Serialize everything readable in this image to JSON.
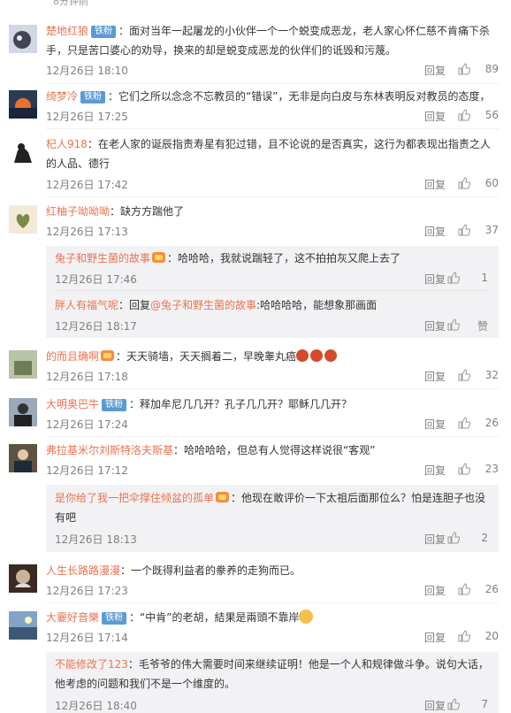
{
  "top_fragment": "8分钟前",
  "reply_label": "回复",
  "comments": [
    {
      "user": "楚地红狼",
      "badge": "铁粉",
      "text": "：面对当年一起屠龙的小伙伴一个一个蜕变成恶龙，老人家心怀仁慈不肯痛下杀手，只是苦口婆心的劝导，换来的却是蜕变成恶龙的伙伴们的诋毁和污蔑。",
      "date": "12月26日 18:10",
      "likes": "89"
    },
    {
      "user": "绮梦冷",
      "badge": "铁粉",
      "text": "：它们之所以念念不忘教员的“错误”，无非是向白皮与东林表明反对教员的态度，",
      "date": "12月26日 17:25",
      "likes": "56"
    },
    {
      "user": "杞人918",
      "badge": "",
      "text": "：在老人家的诞辰指责寿星有犯过错，且不论说的是否真实，这行为都表现出指责之人的人品、德行",
      "date": "12月26日 17:42",
      "likes": "60"
    },
    {
      "user": "红柚子呦呦呦",
      "badge": "",
      "text": "：缺方方踹他了",
      "date": "12月26日 17:13",
      "likes": "37"
    },
    {
      "user": "的而且确啊",
      "badge": "",
      "text": "：天天骑墙，天天搁着二，早晚睾丸癌",
      "date": "12月26日 17:18",
      "likes": "32"
    },
    {
      "user": "大明奥巴牛",
      "badge": "铁粉",
      "text": "：释加牟尼几几开？孔子几几开？耶稣几几开？",
      "date": "12月26日 17:24",
      "likes": "26"
    },
    {
      "user": "弗拉基米尔刘斯特洛夫斯基",
      "badge": "",
      "text": "：哈哈哈哈，但总有人觉得这样说很“客观”",
      "date": "12月26日 17:12",
      "likes": "23"
    },
    {
      "user": "人生长路路漫漫",
      "badge": "",
      "text": "：一个既得利益者的豢养的走狗而已。",
      "date": "12月26日 17:23",
      "likes": "26"
    },
    {
      "user": "大嫑好音樂",
      "badge": "铁粉",
      "text": "：“中肯”的老胡，結果是兩頭不靠岸",
      "date": "12月26日 17:14",
      "likes": "20"
    }
  ],
  "replies": [
    {
      "user": "兔子和野生菌的故事",
      "text": "：哈哈哈，我就说踹轻了，这不拍拍灰又爬上去了",
      "date": "12月26日 17:46",
      "likes": "1"
    },
    {
      "user": "胖人有福气呢",
      "text": "：回复",
      "mention": "@兔子和野生菌的故事",
      "text2": ":哈哈哈哈，能想象那画面",
      "date": "12月26日 18:17",
      "likes": "赞"
    },
    {
      "user": "是你给了我一把伞撑住倾盆的孤单",
      "text": "：他现在敢评价一下太祖后面那位么？怕是连胆子也没有吧",
      "date": "12月26日 18:13",
      "likes": "2"
    },
    {
      "user": "不能修改了123",
      "text": "：毛爷爷的伟大需要时间来继续证明！他是一个人和规律做斗争。说句大话，他考虑的问题和我们不是一个维度的。",
      "date": "12月26日 18:40",
      "likes": "7"
    }
  ],
  "colors": {
    "username": "#eb7350",
    "badge": "#5b9bd5",
    "meta": "#808080",
    "subbg": "#f2f2f5"
  }
}
